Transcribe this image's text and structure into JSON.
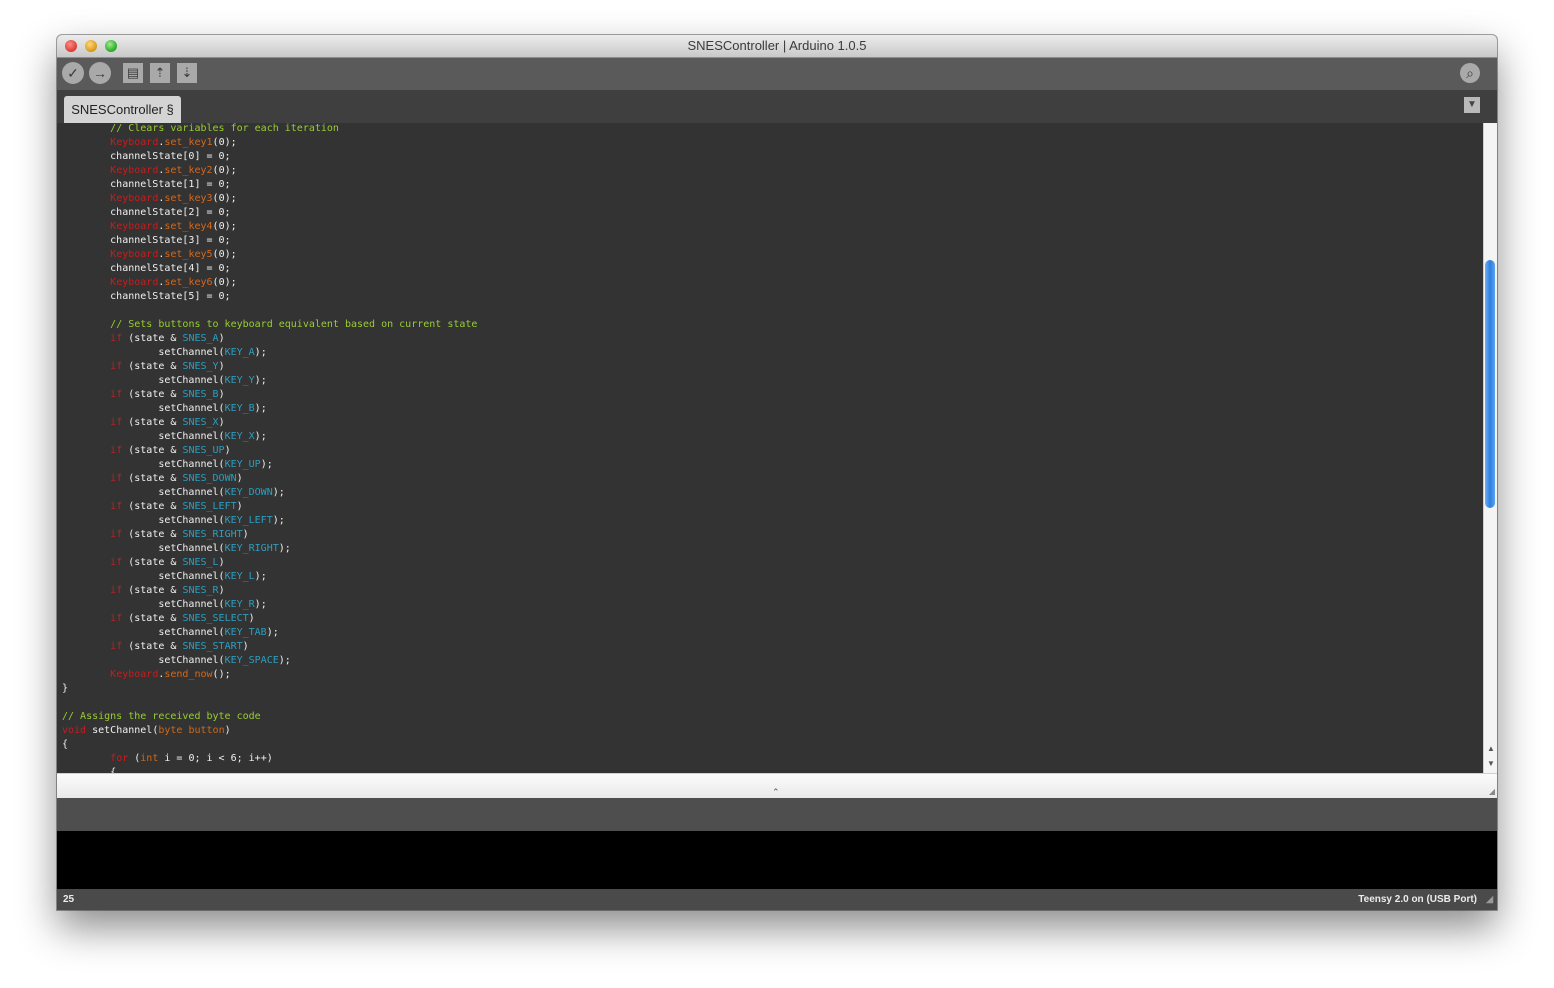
{
  "window": {
    "title": "SNESController | Arduino 1.0.5"
  },
  "toolbar": {
    "verify_icon": "✓",
    "upload_icon": "→",
    "new_icon": "▤",
    "open_icon": "⇡",
    "save_icon": "⇣",
    "serial_monitor_icon": "⌕"
  },
  "tabs": {
    "active_label": "SNESController §",
    "menu_icon": "▼"
  },
  "editor": {
    "lines": [
      [
        {
          "t": "        "
        },
        {
          "t": "// Clears variables for each iteration",
          "c": "c"
        }
      ],
      [
        {
          "t": "        "
        },
        {
          "t": "Keyboard",
          "c": "kw"
        },
        {
          "t": "."
        },
        {
          "t": "set_key1",
          "c": "fn"
        },
        {
          "t": "(0);"
        }
      ],
      [
        {
          "t": "        channelState[0] = 0;"
        }
      ],
      [
        {
          "t": "        "
        },
        {
          "t": "Keyboard",
          "c": "kw"
        },
        {
          "t": "."
        },
        {
          "t": "set_key2",
          "c": "fn"
        },
        {
          "t": "(0);"
        }
      ],
      [
        {
          "t": "        channelState[1] = 0;"
        }
      ],
      [
        {
          "t": "        "
        },
        {
          "t": "Keyboard",
          "c": "kw"
        },
        {
          "t": "."
        },
        {
          "t": "set_key3",
          "c": "fn"
        },
        {
          "t": "(0);"
        }
      ],
      [
        {
          "t": "        channelState[2] = 0;"
        }
      ],
      [
        {
          "t": "        "
        },
        {
          "t": "Keyboard",
          "c": "kw"
        },
        {
          "t": "."
        },
        {
          "t": "set_key4",
          "c": "fn"
        },
        {
          "t": "(0);"
        }
      ],
      [
        {
          "t": "        channelState[3] = 0;"
        }
      ],
      [
        {
          "t": "        "
        },
        {
          "t": "Keyboard",
          "c": "kw"
        },
        {
          "t": "."
        },
        {
          "t": "set_key5",
          "c": "fn"
        },
        {
          "t": "(0);"
        }
      ],
      [
        {
          "t": "        channelState[4] = 0;"
        }
      ],
      [
        {
          "t": "        "
        },
        {
          "t": "Keyboard",
          "c": "kw"
        },
        {
          "t": "."
        },
        {
          "t": "set_key6",
          "c": "fn"
        },
        {
          "t": "(0);"
        }
      ],
      [
        {
          "t": "        channelState[5] = 0;"
        }
      ],
      [
        {
          "t": ""
        }
      ],
      [
        {
          "t": "        "
        },
        {
          "t": "// Sets buttons to keyboard equivalent based on current state",
          "c": "c"
        }
      ],
      [
        {
          "t": "        "
        },
        {
          "t": "if",
          "c": "kw"
        },
        {
          "t": " (state & "
        },
        {
          "t": "SNES_A",
          "c": "cn"
        },
        {
          "t": ")"
        }
      ],
      [
        {
          "t": "                setChannel("
        },
        {
          "t": "KEY_A",
          "c": "cn"
        },
        {
          "t": ");"
        }
      ],
      [
        {
          "t": "        "
        },
        {
          "t": "if",
          "c": "kw"
        },
        {
          "t": " (state & "
        },
        {
          "t": "SNES_Y",
          "c": "cn"
        },
        {
          "t": ")"
        }
      ],
      [
        {
          "t": "                setChannel("
        },
        {
          "t": "KEY_Y",
          "c": "cn"
        },
        {
          "t": ");"
        }
      ],
      [
        {
          "t": "        "
        },
        {
          "t": "if",
          "c": "kw"
        },
        {
          "t": " (state & "
        },
        {
          "t": "SNES_B",
          "c": "cn"
        },
        {
          "t": ")"
        }
      ],
      [
        {
          "t": "                setChannel("
        },
        {
          "t": "KEY_B",
          "c": "cn"
        },
        {
          "t": ");"
        }
      ],
      [
        {
          "t": "        "
        },
        {
          "t": "if",
          "c": "kw"
        },
        {
          "t": " (state & "
        },
        {
          "t": "SNES_X",
          "c": "cn"
        },
        {
          "t": ")"
        }
      ],
      [
        {
          "t": "                setChannel("
        },
        {
          "t": "KEY_X",
          "c": "cn"
        },
        {
          "t": ");"
        }
      ],
      [
        {
          "t": "        "
        },
        {
          "t": "if",
          "c": "kw"
        },
        {
          "t": " (state & "
        },
        {
          "t": "SNES_UP",
          "c": "cn"
        },
        {
          "t": ")"
        }
      ],
      [
        {
          "t": "                setChannel("
        },
        {
          "t": "KEY_UP",
          "c": "cn"
        },
        {
          "t": ");"
        }
      ],
      [
        {
          "t": "        "
        },
        {
          "t": "if",
          "c": "kw"
        },
        {
          "t": " (state & "
        },
        {
          "t": "SNES_DOWN",
          "c": "cn"
        },
        {
          "t": ")"
        }
      ],
      [
        {
          "t": "                setChannel("
        },
        {
          "t": "KEY_DOWN",
          "c": "cn"
        },
        {
          "t": ");"
        }
      ],
      [
        {
          "t": "        "
        },
        {
          "t": "if",
          "c": "kw"
        },
        {
          "t": " (state & "
        },
        {
          "t": "SNES_LEFT",
          "c": "cn"
        },
        {
          "t": ")"
        }
      ],
      [
        {
          "t": "                setChannel("
        },
        {
          "t": "KEY_LEFT",
          "c": "cn"
        },
        {
          "t": ");"
        }
      ],
      [
        {
          "t": "        "
        },
        {
          "t": "if",
          "c": "kw"
        },
        {
          "t": " (state & "
        },
        {
          "t": "SNES_RIGHT",
          "c": "cn"
        },
        {
          "t": ")"
        }
      ],
      [
        {
          "t": "                setChannel("
        },
        {
          "t": "KEY_RIGHT",
          "c": "cn"
        },
        {
          "t": ");"
        }
      ],
      [
        {
          "t": "        "
        },
        {
          "t": "if",
          "c": "kw"
        },
        {
          "t": " (state & "
        },
        {
          "t": "SNES_L",
          "c": "cn"
        },
        {
          "t": ")"
        }
      ],
      [
        {
          "t": "                setChannel("
        },
        {
          "t": "KEY_L",
          "c": "cn"
        },
        {
          "t": ");"
        }
      ],
      [
        {
          "t": "        "
        },
        {
          "t": "if",
          "c": "kw"
        },
        {
          "t": " (state & "
        },
        {
          "t": "SNES_R",
          "c": "cn"
        },
        {
          "t": ")"
        }
      ],
      [
        {
          "t": "                setChannel("
        },
        {
          "t": "KEY_R",
          "c": "cn"
        },
        {
          "t": ");"
        }
      ],
      [
        {
          "t": "        "
        },
        {
          "t": "if",
          "c": "kw"
        },
        {
          "t": " (state & "
        },
        {
          "t": "SNES_SELECT",
          "c": "cn"
        },
        {
          "t": ")"
        }
      ],
      [
        {
          "t": "                setChannel("
        },
        {
          "t": "KEY_TAB",
          "c": "cn"
        },
        {
          "t": ");"
        }
      ],
      [
        {
          "t": "        "
        },
        {
          "t": "if",
          "c": "kw"
        },
        {
          "t": " (state & "
        },
        {
          "t": "SNES_START",
          "c": "cn"
        },
        {
          "t": ")"
        }
      ],
      [
        {
          "t": "                setChannel("
        },
        {
          "t": "KEY_SPACE",
          "c": "cn"
        },
        {
          "t": ");"
        }
      ],
      [
        {
          "t": "        "
        },
        {
          "t": "Keyboard",
          "c": "kw"
        },
        {
          "t": "."
        },
        {
          "t": "send_now",
          "c": "fn"
        },
        {
          "t": "();"
        }
      ],
      [
        {
          "t": "}"
        }
      ],
      [
        {
          "t": ""
        }
      ],
      [
        {
          "t": "// Assigns the received byte code",
          "c": "c"
        }
      ],
      [
        {
          "t": "void",
          "c": "kw"
        },
        {
          "t": " setChannel("
        },
        {
          "t": "byte",
          "c": "ty"
        },
        {
          "t": " "
        },
        {
          "t": "button",
          "c": "ty"
        },
        {
          "t": ")"
        }
      ],
      [
        {
          "t": "{"
        }
      ],
      [
        {
          "t": "        "
        },
        {
          "t": "for",
          "c": "kw"
        },
        {
          "t": " ("
        },
        {
          "t": "int",
          "c": "ty"
        },
        {
          "t": " i = 0; i < 6; i++)"
        }
      ],
      [
        {
          "t": "        {"
        }
      ]
    ]
  },
  "scrollbar": {
    "up_arrow": "▲",
    "down_arrow": "▼"
  },
  "divider": {
    "grip": "⌃",
    "corner": "◢"
  },
  "status": {
    "line_number": "25",
    "board": "Teensy 2.0 on (USB Port)",
    "resize_grip": "◢"
  },
  "colors": {
    "editor_bg": "#333333",
    "comment": "#9acd32",
    "keyword": "#cc1b1b",
    "function": "#d2691e",
    "constant": "#2a9fc0",
    "type": "#cc6a1b",
    "console_bg": "#000000"
  }
}
